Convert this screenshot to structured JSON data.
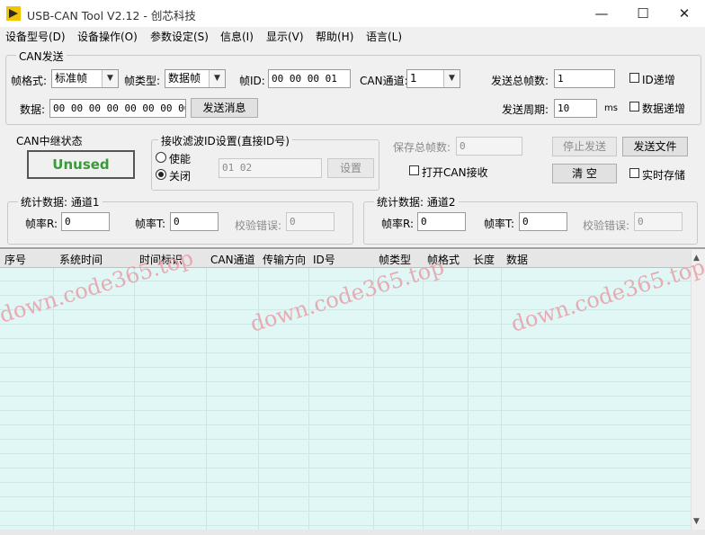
{
  "window": {
    "title": "USB-CAN Tool V2.12 - 创芯科技",
    "minimize_glyph": "—",
    "maximize_glyph": "☐",
    "close_glyph": "✕"
  },
  "menu": [
    "设备型号(D)",
    "设备操作(O)",
    "参数设定(S)",
    "信息(I)",
    "显示(V)",
    "帮助(H)",
    "语言(L)"
  ],
  "can_send": {
    "group_label": "CAN发送",
    "frame_format_label": "帧格式:",
    "frame_format_value": "标准帧",
    "frame_type_label": "帧类型:",
    "frame_type_value": "数据帧",
    "frame_id_label": "帧ID:",
    "frame_id_value": "00 00 00 01",
    "channel_label": "CAN通道:",
    "channel_value": "1",
    "total_frames_label": "发送总帧数:",
    "total_frames_value": "1",
    "id_increment_label": "ID递增",
    "data_label": "数据:",
    "data_value": "00 00 00 00 00 00 00 00",
    "send_button": "发送消息",
    "period_label": "发送周期:",
    "period_value": "10",
    "period_unit": "ms",
    "data_increment_label": "数据递增"
  },
  "relay": {
    "label": "CAN中继状态",
    "status": "Unused"
  },
  "filter": {
    "label": "接收滤波ID设置(直接ID号)",
    "enable_label": "使能",
    "disable_label": "关闭",
    "ids_value": "01 02",
    "set_button": "设置"
  },
  "save": {
    "total_label": "保存总帧数:",
    "total_value": "0",
    "open_receive_label": "打开CAN接收",
    "stop_button": "停止发送",
    "send_file_button": "发送文件",
    "clear_button": "清 空",
    "realtime_label": "实时存储"
  },
  "stats1": {
    "label": "统计数据: 通道1",
    "rx_label": "帧率R:",
    "rx_value": "0",
    "tx_label": "帧率T:",
    "tx_value": "0",
    "err_label": "校验错误:",
    "err_value": "0"
  },
  "stats2": {
    "label": "统计数据: 通道2",
    "rx_label": "帧率R:",
    "rx_value": "0",
    "tx_label": "帧率T:",
    "tx_value": "0",
    "err_label": "校验错误:",
    "err_value": "0"
  },
  "table": {
    "columns": [
      "序号",
      "系统时间",
      "时间标识",
      "CAN通道",
      "传输方向",
      "ID号",
      "帧类型",
      "帧格式",
      "长度",
      "数据"
    ]
  },
  "watermark": "down.code365.top",
  "colors": {
    "relay_text": "#3a9a3a",
    "table_bg": "#e0f7f5",
    "watermark": "#e8a0a8"
  }
}
